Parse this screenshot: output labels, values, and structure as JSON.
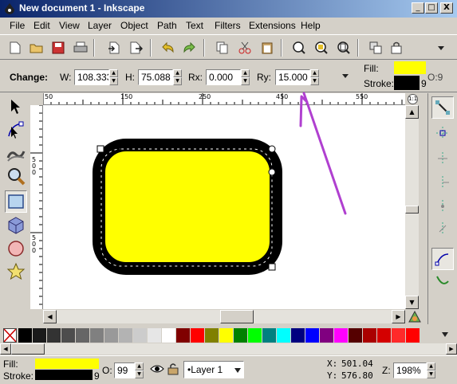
{
  "window": {
    "title": "New document 1 - Inkscape",
    "controls": [
      "_",
      "□",
      "X"
    ]
  },
  "menu": [
    "File",
    "Edit",
    "View",
    "Layer",
    "Object",
    "Path",
    "Text",
    "Filters",
    "Extensions",
    "Help"
  ],
  "commands": [
    "new-icon",
    "open-icon",
    "save-icon",
    "print-icon",
    "import-icon",
    "export-icon",
    "undo-icon",
    "redo-icon",
    "copy-icon",
    "cut-icon",
    "paste-icon",
    "zoom-selection-icon",
    "zoom-drawing-icon",
    "zoom-page-icon",
    "duplicate-icon",
    "clone-icon",
    "more-icon"
  ],
  "tool_controls": {
    "change_label": "Change:",
    "w_label": "W:",
    "w_value": "108.333",
    "h_label": "H:",
    "h_value": "75.088",
    "rx_label": "Rx:",
    "rx_value": "0.000",
    "ry_label": "Ry:",
    "ry_value": "15.000"
  },
  "style_indicator": {
    "fill_label": "Fill:",
    "stroke_label": "Stroke:",
    "fill_color": "#ffff00",
    "stroke_color": "#000000",
    "stroke_width": "9",
    "opacity_label": "O:9"
  },
  "tools": [
    "selector-tool-icon",
    "node-tool-icon",
    "tweak-tool-icon",
    "zoom-tool-icon",
    "rectangle-tool-icon",
    "3dbox-tool-icon",
    "ellipse-tool-icon",
    "star-tool-icon"
  ],
  "rulers": {
    "horizontal_ticks": [
      "50",
      "100",
      "150",
      "200",
      "250",
      "300",
      "350",
      "400",
      "450",
      "500",
      "550"
    ],
    "vertical_ticks": [
      "5",
      "0",
      "0",
      "5",
      "0",
      "0"
    ]
  },
  "palette": {
    "colors": [
      "#000000",
      "#1a1a1a",
      "#333333",
      "#4d4d4d",
      "#666666",
      "#808080",
      "#999999",
      "#b3b3b3",
      "#cccccc",
      "#e6e6e6",
      "#ffffff",
      "#800000",
      "#ff0000",
      "#808000",
      "#ffff00",
      "#008000",
      "#00ff00",
      "#008080",
      "#00ffff",
      "#000080",
      "#0000ff",
      "#800080",
      "#ff00ff",
      "#550000",
      "#aa0000",
      "#d40000",
      "#ff2a2a",
      "#ff0000"
    ]
  },
  "status": {
    "fill_label": "Fill:",
    "stroke_label": "Stroke:",
    "fill_color": "#ffff00",
    "stroke_color": "#000000",
    "stroke_width": "9",
    "opacity_label": "O:",
    "opacity_value": "99",
    "layer_value": "•Layer 1",
    "x_label": "X:",
    "x_value": "501.04",
    "y_label": "Y:",
    "y_value": "576.80",
    "zoom_label": "Z:",
    "zoom_value": "198%"
  },
  "colors": {
    "annotation_arrow": "#b040d0",
    "title_bar_start": "#0a246a",
    "title_bar_end": "#a6caf0"
  }
}
